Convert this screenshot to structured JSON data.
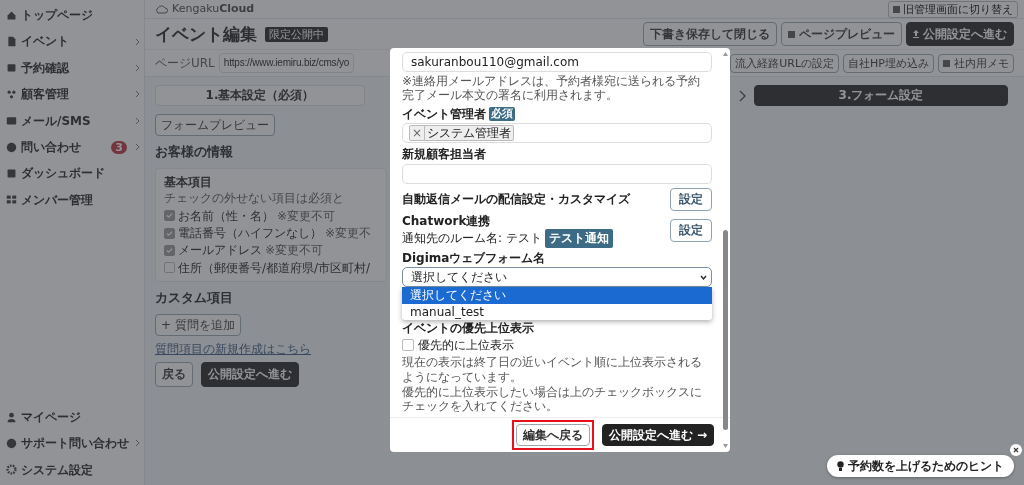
{
  "sidebar": {
    "items": [
      {
        "label": "トップページ",
        "has_submenu": false
      },
      {
        "label": "イベント",
        "has_submenu": true
      },
      {
        "label": "予約確認",
        "has_submenu": true
      },
      {
        "label": "顧客管理",
        "has_submenu": true
      },
      {
        "label": "メール/SMS",
        "has_submenu": true
      },
      {
        "label": "問い合わせ",
        "has_submenu": true,
        "badge": "3"
      },
      {
        "label": "ダッシュボード",
        "has_submenu": false
      },
      {
        "label": "メンバー管理",
        "has_submenu": false
      }
    ],
    "footer_items": [
      {
        "label": "マイページ",
        "has_submenu": false
      },
      {
        "label": "サポート問い合わせ",
        "has_submenu": true
      },
      {
        "label": "システム設定",
        "has_submenu": false
      }
    ]
  },
  "header": {
    "logo": "Kengaku**Cloud**",
    "switch_button": "旧管理画面に切り替え"
  },
  "page": {
    "title": "イベント編集",
    "status_badge": "限定公開中",
    "actions": [
      {
        "label": "下書き保存して閉じる",
        "kind": "outline"
      },
      {
        "label": "ページプレビュー",
        "kind": "preview"
      },
      {
        "label": "公開設定へ進む",
        "kind": "dark"
      }
    ],
    "url_label": "ページURL",
    "url": "https://www.iemiru.biz/cms/yo",
    "link_buttons": [
      {
        "label": "流入経路URLの設定",
        "kind": "plain"
      },
      {
        "label": "自社HP埋め込み",
        "kind": "plain"
      },
      {
        "label": "社内用メモ",
        "kind": "memo"
      }
    ],
    "steps": [
      {
        "label": "1.基本設定（必須）",
        "selected": false
      },
      {
        "label": "3.フォーム設定",
        "selected": true
      }
    ],
    "preview_button": "フォームプレビュー",
    "section_title": "お客様の情報",
    "basic_card": {
      "title": "基本項目",
      "note": "チェックの外せない項目は必須と",
      "fields": [
        {
          "label": "お名前（性・名）",
          "note": "※変更不可",
          "checked": true
        },
        {
          "label": "電話番号（ハイフンなし）",
          "note": "※変更不",
          "checked": true
        },
        {
          "label": "メールアドレス",
          "note": "※変更不可",
          "checked": true
        },
        {
          "label": "住所（郵便番号/都道府県/市区町村/",
          "checked": false
        }
      ]
    },
    "custom": {
      "title": "カスタム項目",
      "add_button": "+ 質問を追加",
      "link": "質問項目の新規作成はこちら",
      "back_button": "戻る",
      "next_button": "公開設定へ進む"
    }
  },
  "modal": {
    "email_field": {
      "value": "sakuranbou110@gmail.com"
    },
    "email_note": "※連絡用メールアドレスは、予約者様宛に送られる予約完了メール本文の署名に利用されます。",
    "manager": {
      "label": "イベント管理者",
      "required_badge": "必須",
      "chips": [
        {
          "remove": "×",
          "label": "システム管理者"
        }
      ]
    },
    "new_customer": {
      "label": "新規顧客担当者"
    },
    "autoreply": {
      "label": "自動返信メールの配信設定・カスタマイズ",
      "button": "設定"
    },
    "chatwork": {
      "label": "Chatwork連携",
      "room_text": "通知先のルーム名: テスト",
      "test_button": "テスト通知",
      "button": "設定"
    },
    "digima": {
      "label": "Digimaウェブフォーム名",
      "value": "選択してください",
      "options": [
        {
          "label": "選択してください",
          "selected": true
        },
        {
          "label": "manual_test",
          "selected": false
        }
      ]
    },
    "priority": {
      "label": "イベントの優先上位表示",
      "checkbox": {
        "label": "優先的に上位表示",
        "checked": false
      },
      "notes": [
        "現在の表示は終了日の近いイベント順に上位表示されるようになっています。",
        "優先的に上位表示したい場合は上のチェックボックスにチェックを入れてください。"
      ]
    },
    "footer_buttons": [
      {
        "label": "編集へ戻る",
        "kind": "outline",
        "highlighted": true
      },
      {
        "label": "公開設定へ進む →",
        "kind": "dark",
        "highlighted": false
      }
    ]
  },
  "hint": {
    "label": "予約数を上げるためのヒント"
  }
}
